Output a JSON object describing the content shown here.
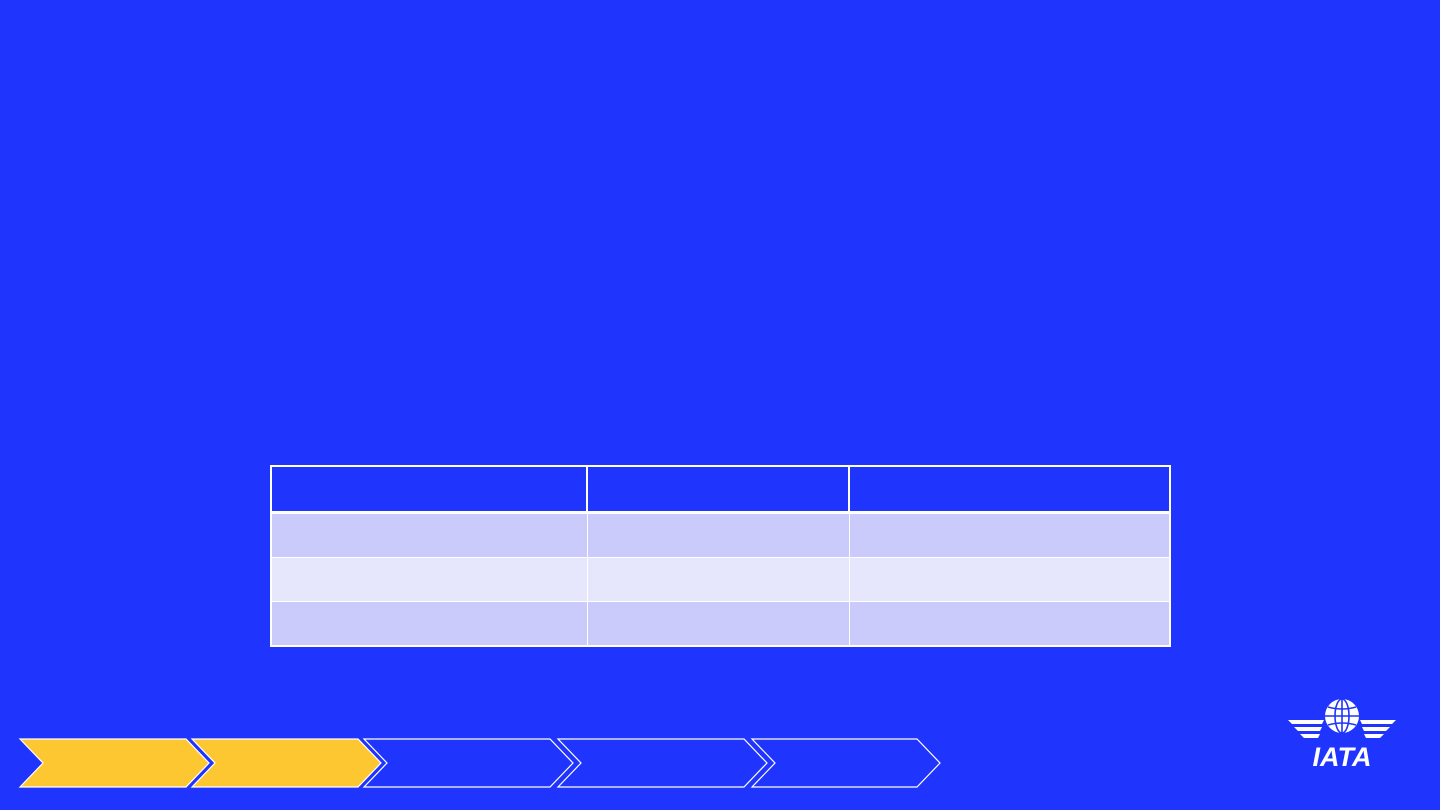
{
  "slide": {
    "background_color": "#1f34fc"
  },
  "table": {
    "columns": [
      "",
      "",
      ""
    ],
    "rows": [
      [
        "",
        "",
        ""
      ],
      [
        "",
        "",
        ""
      ],
      [
        "",
        "",
        ""
      ]
    ],
    "header_color": "#1f34fc",
    "row_colors": [
      "#cbcbfb",
      "#e6e7fc",
      "#cbcbfb"
    ]
  },
  "progress": {
    "steps_total": 5,
    "steps_completed": 2,
    "completed_color": "#fdc732",
    "pending_outline_color": "#ffffff"
  },
  "logo": {
    "text": "IATA",
    "icon": "globe-wings-icon"
  }
}
